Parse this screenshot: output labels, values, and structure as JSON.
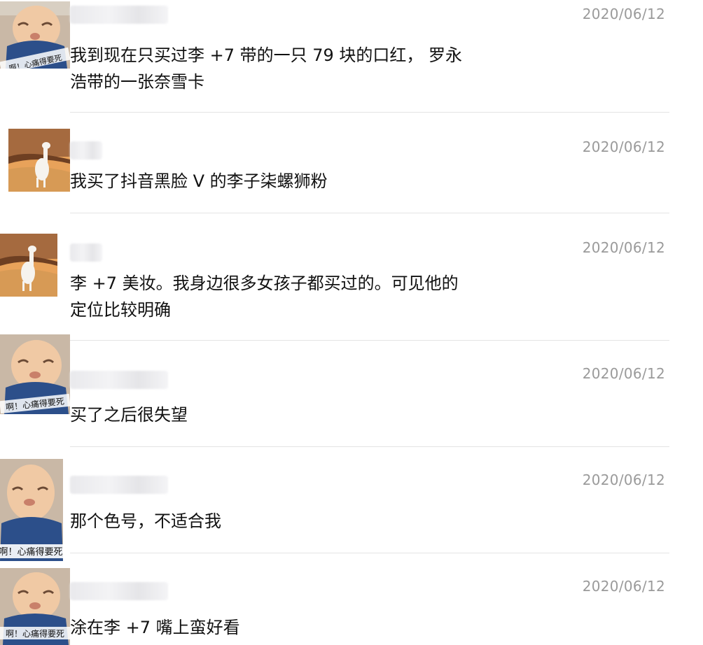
{
  "comments": [
    {
      "avatar_icon": "crying-baby-sticker-icon",
      "avatar_caption": "啊！心痛得要死",
      "date": "2020/06/12",
      "text_lines": [
        "我到现在只买过李 +7 带的一只 79 块的口红， 罗永",
        "浩带的一张奈雪卡"
      ]
    },
    {
      "avatar_icon": "alpaca-desert-icon",
      "date": "2020/06/12",
      "text_lines": [
        "我买了抖音黑脸 V 的李子柒螺狮粉"
      ]
    },
    {
      "avatar_icon": "alpaca-desert-icon",
      "date": "2020/06/12",
      "text_lines": [
        "李 +7 美妆。我身边很多女孩子都买过的。可见他的",
        "定位比较明确"
      ]
    },
    {
      "avatar_icon": "crying-baby-sticker-icon",
      "avatar_caption": "啊！心痛得要死",
      "date": "2020/06/12",
      "text_lines": [
        "买了之后很失望"
      ]
    },
    {
      "avatar_icon": "crying-baby-sticker-icon",
      "avatar_caption": "啊！心痛得要死",
      "date": "2020/06/12",
      "text_lines": [
        "那个色号，不适合我"
      ]
    },
    {
      "avatar_icon": "crying-baby-sticker-icon",
      "avatar_caption": "啊！心痛得要死",
      "date": "2020/06/12",
      "text_lines": [
        "涂在李 +7 嘴上蛮好看"
      ]
    }
  ],
  "colors": {
    "date": "#9a9a9a",
    "text": "#111111",
    "divider": "#e4e4e4",
    "baby_shirt": "#2c4f8a",
    "desert_sky": "#e8a25a"
  }
}
